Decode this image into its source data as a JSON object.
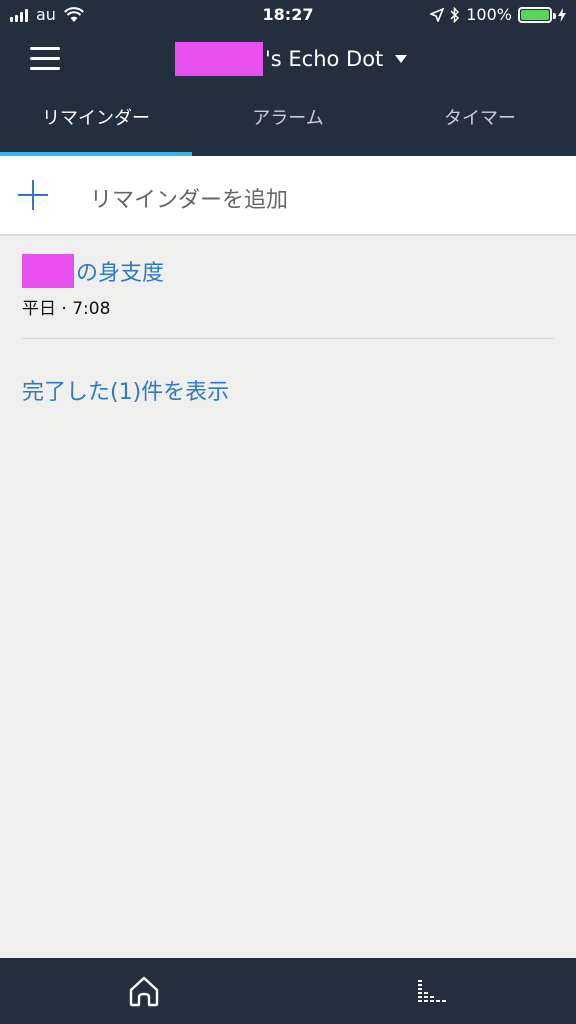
{
  "status_bar": {
    "carrier": "au",
    "time": "18:27",
    "battery": "100%",
    "battery_level": 1.0
  },
  "nav": {
    "device_name": "'s Echo Dot"
  },
  "tabs": [
    {
      "label": "リマインダー"
    },
    {
      "label": "アラーム"
    },
    {
      "label": "タイマー"
    }
  ],
  "add_reminder": {
    "label": "リマインダーを追加"
  },
  "reminder": {
    "title_suffix": "の身支度",
    "schedule": "平日 · 7:08"
  },
  "completed": {
    "label": "完了した(1)件を表示"
  },
  "colors": {
    "header": "#232f3e",
    "accent_blue": "#2f78c6",
    "tab_underline": "#39b5e8",
    "redaction": "#e84ff0",
    "battery": "#58d35f"
  },
  "icons": {
    "menu": "hamburger-icon",
    "home": "home-icon",
    "now_playing": "equalizer-icon",
    "add": "plus-icon"
  }
}
